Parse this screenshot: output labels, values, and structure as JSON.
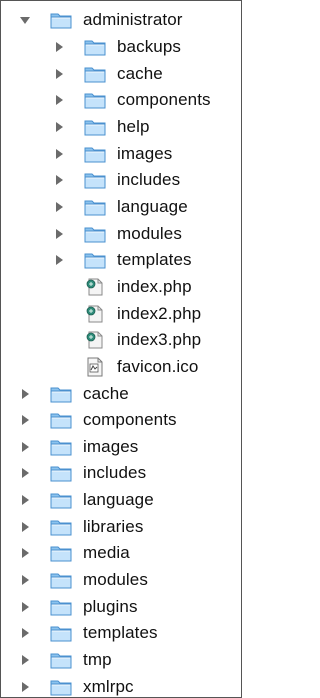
{
  "tree": {
    "items": [
      {
        "label": "administrator",
        "level": 0,
        "type": "folder",
        "expanded": true,
        "icon": "folder-icon"
      },
      {
        "label": "backups",
        "level": 1,
        "type": "folder",
        "expanded": false,
        "icon": "folder-icon"
      },
      {
        "label": "cache",
        "level": 1,
        "type": "folder",
        "expanded": false,
        "icon": "folder-icon"
      },
      {
        "label": "components",
        "level": 1,
        "type": "folder",
        "expanded": false,
        "icon": "folder-icon"
      },
      {
        "label": "help",
        "level": 1,
        "type": "folder",
        "expanded": false,
        "icon": "folder-icon"
      },
      {
        "label": "images",
        "level": 1,
        "type": "folder",
        "expanded": false,
        "icon": "folder-icon"
      },
      {
        "label": "includes",
        "level": 1,
        "type": "folder",
        "expanded": false,
        "icon": "folder-icon"
      },
      {
        "label": "language",
        "level": 1,
        "type": "folder",
        "expanded": false,
        "icon": "folder-icon"
      },
      {
        "label": "modules",
        "level": 1,
        "type": "folder",
        "expanded": false,
        "icon": "folder-icon"
      },
      {
        "label": "templates",
        "level": 1,
        "type": "folder",
        "expanded": false,
        "icon": "folder-icon"
      },
      {
        "label": "index.php",
        "level": 1,
        "type": "file",
        "icon": "php-file-icon"
      },
      {
        "label": "index2.php",
        "level": 1,
        "type": "file",
        "icon": "php-file-icon"
      },
      {
        "label": "index3.php",
        "level": 1,
        "type": "file",
        "icon": "php-file-icon"
      },
      {
        "label": "favicon.ico",
        "level": 1,
        "type": "file",
        "icon": "ico-file-icon"
      },
      {
        "label": "cache",
        "level": 0,
        "type": "folder",
        "expanded": false,
        "icon": "folder-icon"
      },
      {
        "label": "components",
        "level": 0,
        "type": "folder",
        "expanded": false,
        "icon": "folder-icon"
      },
      {
        "label": "images",
        "level": 0,
        "type": "folder",
        "expanded": false,
        "icon": "folder-icon"
      },
      {
        "label": "includes",
        "level": 0,
        "type": "folder",
        "expanded": false,
        "icon": "folder-icon"
      },
      {
        "label": "language",
        "level": 0,
        "type": "folder",
        "expanded": false,
        "icon": "folder-icon"
      },
      {
        "label": "libraries",
        "level": 0,
        "type": "folder",
        "expanded": false,
        "icon": "folder-icon"
      },
      {
        "label": "media",
        "level": 0,
        "type": "folder",
        "expanded": false,
        "icon": "folder-icon"
      },
      {
        "label": "modules",
        "level": 0,
        "type": "folder",
        "expanded": false,
        "icon": "folder-icon"
      },
      {
        "label": "plugins",
        "level": 0,
        "type": "folder",
        "expanded": false,
        "icon": "folder-icon"
      },
      {
        "label": "templates",
        "level": 0,
        "type": "folder",
        "expanded": false,
        "icon": "folder-icon"
      },
      {
        "label": "tmp",
        "level": 0,
        "type": "folder",
        "expanded": false,
        "icon": "folder-icon"
      },
      {
        "label": "xmlrpc",
        "level": 0,
        "type": "folder",
        "expanded": false,
        "icon": "folder-icon"
      }
    ]
  },
  "colors": {
    "disclosure": "#6b6b6b",
    "folder_light": "#c5e3fb",
    "folder_mid": "#8cc3ee",
    "folder_dark": "#4a90cf",
    "text": "#111111",
    "border": "#555555"
  }
}
